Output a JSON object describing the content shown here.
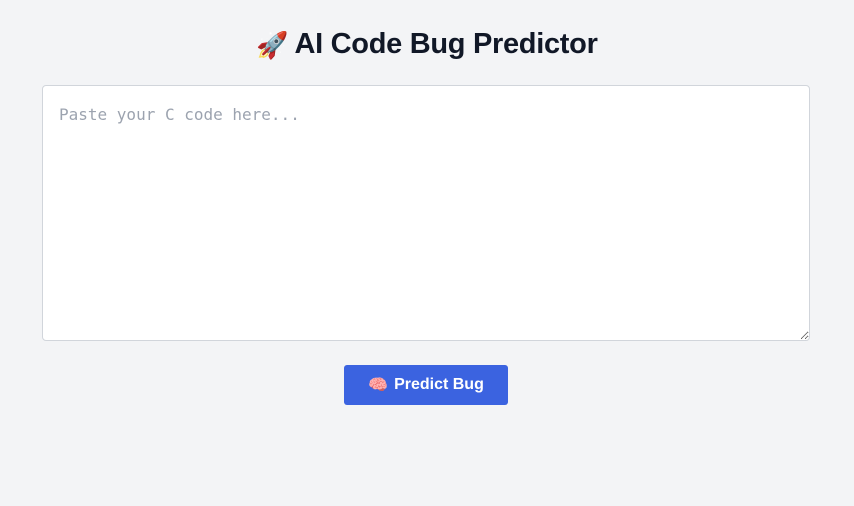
{
  "header": {
    "title_icon": "🚀",
    "title_icon_name": "rocket-icon",
    "title": "AI Code Bug Predictor"
  },
  "editor": {
    "placeholder": "Paste your C code here...",
    "value": ""
  },
  "actions": {
    "predict_icon": "🧠",
    "predict_icon_name": "brain-icon",
    "predict_label": "Predict Bug"
  },
  "colors": {
    "background": "#f3f4f6",
    "title_text": "#111827",
    "button_bg": "#3b63e0",
    "button_text": "#ffffff",
    "input_border": "#d1d5db"
  }
}
